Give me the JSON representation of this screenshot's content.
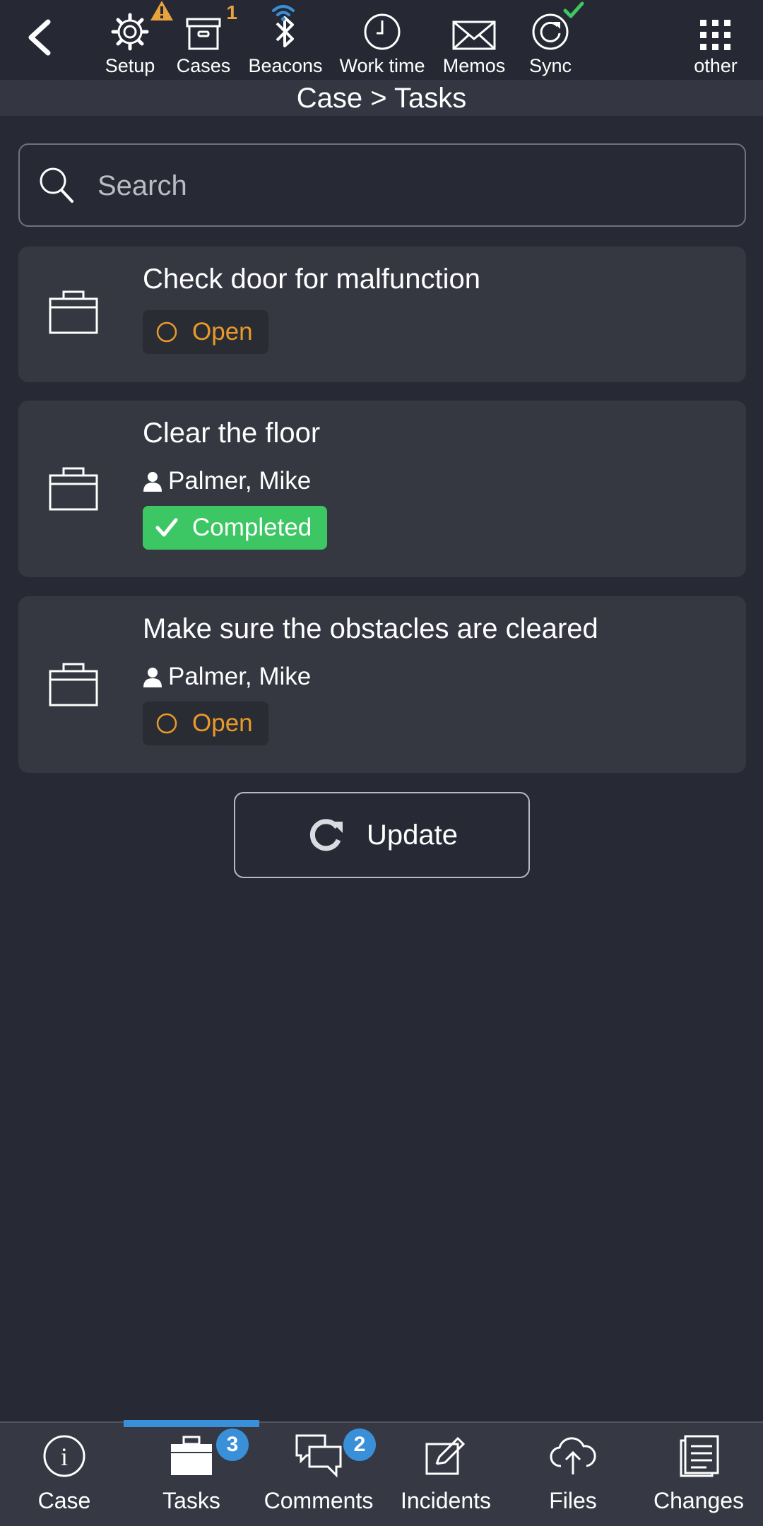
{
  "toolbar": {
    "items": [
      {
        "label": "Setup",
        "icon": "gear-icon",
        "warning": true
      },
      {
        "label": "Cases",
        "icon": "archive-box-icon",
        "count": "1"
      },
      {
        "label": "Beacons",
        "icon": "bluetooth-icon"
      },
      {
        "label": "Work time",
        "icon": "clock-icon"
      },
      {
        "label": "Memos",
        "icon": "envelope-icon"
      },
      {
        "label": "Sync",
        "icon": "sync-icon",
        "synced": true
      },
      {
        "label": "other",
        "icon": "grid-icon"
      }
    ]
  },
  "breadcrumb": "Case > Tasks",
  "search": {
    "placeholder": "Search",
    "value": ""
  },
  "tasks": [
    {
      "title": "Check door for malfunction",
      "assignee": null,
      "status": "Open",
      "status_type": "open"
    },
    {
      "title": "Clear the floor",
      "assignee": "Palmer, Mike",
      "status": "Completed",
      "status_type": "completed"
    },
    {
      "title": "Make sure the obstacles are cleared",
      "assignee": "Palmer, Mike",
      "status": "Open",
      "status_type": "open"
    }
  ],
  "update_label": "Update",
  "bottom_nav": {
    "active": "Tasks",
    "items": [
      {
        "label": "Case",
        "icon": "info-icon"
      },
      {
        "label": "Tasks",
        "icon": "briefcase-icon",
        "badge": "3"
      },
      {
        "label": "Comments",
        "icon": "comments-icon",
        "badge": "2"
      },
      {
        "label": "Incidents",
        "icon": "edit-icon"
      },
      {
        "label": "Files",
        "icon": "cloud-upload-icon"
      },
      {
        "label": "Changes",
        "icon": "document-list-icon"
      }
    ]
  },
  "colors": {
    "background": "#272a35",
    "card": "#353741",
    "open_status": "#e89a2b",
    "completed_status": "#3dc764",
    "accent": "#3a8fd9",
    "warning": "#e8a33d",
    "sync_ok": "#3dc764"
  }
}
